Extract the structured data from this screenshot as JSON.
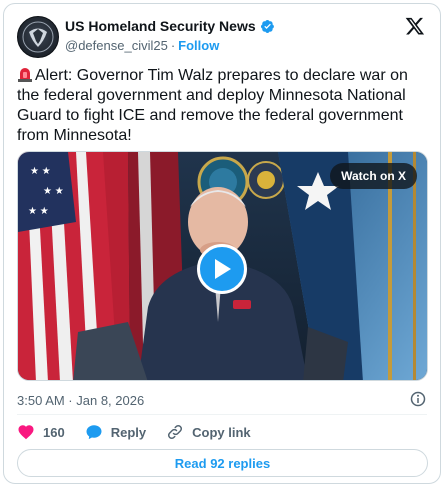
{
  "author": {
    "name": "US Homeland Security News",
    "handle": "@defense_civil25",
    "separator": "·",
    "follow_label": "Follow"
  },
  "tweet": {
    "text": "Alert: Governor Tim Walz prepares to declare war on the federal government and deploy Minnesota National Guard to fight ICE and remove the federal government from Minnesota!",
    "timestamp": "3:50 AM · Jan 8, 2026"
  },
  "media": {
    "badge": "Watch on X"
  },
  "actions": {
    "likes": "160",
    "reply_label": "Reply",
    "copy_link_label": "Copy link"
  },
  "footer": {
    "read_replies_label": "Read 92 replies"
  },
  "colors": {
    "accent": "#1d9bf0",
    "like": "#f91880",
    "muted": "#536471"
  }
}
